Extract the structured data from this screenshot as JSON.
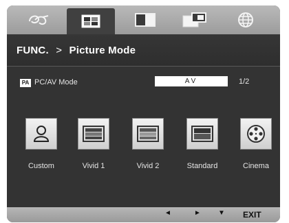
{
  "tabs": [
    {
      "icon": "eco-icon"
    },
    {
      "icon": "picture-icon"
    },
    {
      "icon": "split-screen-icon"
    },
    {
      "icon": "pip-icon"
    },
    {
      "icon": "globe-icon"
    }
  ],
  "header": {
    "func": "FUNC.",
    "separator": ">",
    "title": "Picture Mode"
  },
  "setting": {
    "badge": "PA",
    "label": "PC/AV Mode",
    "value": "AV",
    "page": "1/2"
  },
  "modes": [
    {
      "label": "Custom",
      "icon": "person-icon"
    },
    {
      "label": "Vivid 1",
      "icon": "vivid1-icon"
    },
    {
      "label": "Vivid 2",
      "icon": "vivid2-icon"
    },
    {
      "label": "Standard",
      "icon": "standard-icon"
    },
    {
      "label": "Cinema",
      "icon": "film-reel-icon"
    }
  ],
  "footer": {
    "left": "◄",
    "right": "►",
    "down": "▼",
    "exit": "EXIT"
  }
}
